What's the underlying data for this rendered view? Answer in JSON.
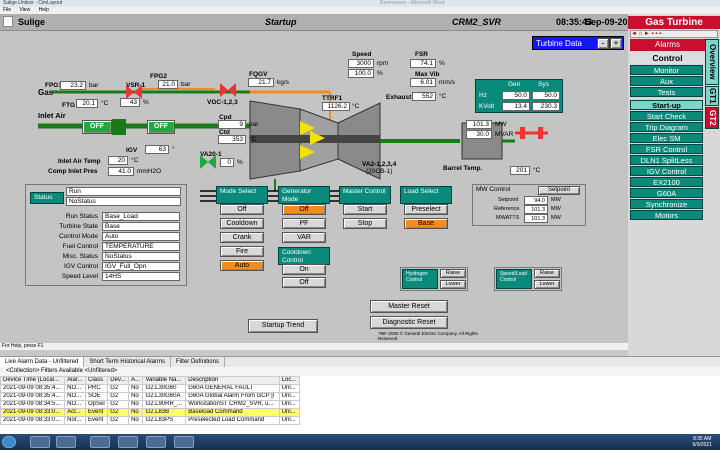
{
  "window": {
    "title": "Sulige.Unitsvr - CimLayout",
    "ghost_title": "Rasmussen - Microsoft Word",
    "menu": [
      "File",
      "View",
      "Help"
    ]
  },
  "header": {
    "site": "Sulige",
    "screen": "Startup",
    "unit": "CRM2_SVR",
    "time": "08:35:43",
    "date": "Sep-09-2021"
  },
  "turbine_data": {
    "label": "Turbine Data",
    "minus": "-",
    "plus": "+"
  },
  "speed": {
    "label": "Speed",
    "rpm": "3000",
    "rpm_unit": "rpm",
    "pct": "100.0",
    "pct_unit": "%"
  },
  "fsr": {
    "label": "FSR",
    "value": "74.1",
    "unit": "%"
  },
  "max_vib": {
    "label": "Max Vib",
    "value": "6.01",
    "unit": "mm/s"
  },
  "exhaust": {
    "label": "Exhaust",
    "value": "552",
    "unit": "°C"
  },
  "gen": {
    "gen_label": "Gen",
    "sys_label": "Sys",
    "hz_label": "Hz",
    "hz_gen": "50.0",
    "hz_sys": "50.0",
    "kv_label": "KVolt",
    "kv_gen": "13.4",
    "kv_sys": "230.3"
  },
  "fuel": {
    "fpg1_label": "FPG1",
    "fpg1": "23.2",
    "fpg1_unit": "bar",
    "gas_label": "Gas",
    "ftg_label": "FTG",
    "ftg": "20.1",
    "ftg_unit": "°C",
    "vsr_label": "VSR-1",
    "vsr": "43",
    "vsr_unit": "%",
    "fpg2_label": "FPG2",
    "fpg2": "21.0",
    "fpg2_unit": "bar",
    "fqgv_label": "FQGV",
    "fqgv": "21.7",
    "fqgv_unit": "kg/s",
    "vgc_label": "VGC-1,2,3",
    "ttrf1_label": "TTRF1",
    "ttrf1": "1126.2",
    "ttrf1_unit": "°C"
  },
  "compressor": {
    "inlet_air_label": "Inlet Air",
    "off1": "OFF",
    "off2": "OFF",
    "igv_label": "IGV",
    "igv": "63",
    "igv_unit": "°",
    "cpd_label": "Cpd",
    "cpd": "9",
    "cpd_unit": "bar",
    "ctd_label": "Ctd",
    "ctd": "353",
    "ctd_unit": "°C",
    "va20_label": "VA20-1",
    "va20": "0",
    "va20_unit": "%",
    "inlet_air_temp_label": "Inlet Air Temp",
    "inlet_air_temp": "20",
    "inlet_air_temp_unit": "°C",
    "comp_inlet_pres_label": "Comp Inlet Pres",
    "comp_inlet_pres": "41.0",
    "comp_inlet_pres_unit": "mmH2O",
    "va2_label": "VA2-1,2,3,4",
    "va2_sub": "(20CB-1)",
    "barrel_temp_label": "Barrel Temp.",
    "barrel_temp": "201",
    "barrel_temp_unit": "°C"
  },
  "generator": {
    "mw": "101.3",
    "mw_unit": "MW",
    "mvar": "30.0",
    "mvar_unit": "MVAR"
  },
  "status_panel": {
    "status_label": "Status",
    "status1": "Run",
    "status2": "NoStatus",
    "rows": [
      {
        "label": "Run Status",
        "value": "Base_Load"
      },
      {
        "label": "Turbine State",
        "value": "Base"
      },
      {
        "label": "Control Mode",
        "value": "Auto"
      },
      {
        "label": "Fuel Control",
        "value": "TEMPERATURE"
      },
      {
        "label": "Misc. Status",
        "value": "NoStatus"
      },
      {
        "label": "IGV Control",
        "value": "IGV_Full_Opn"
      },
      {
        "label": "Speed Level",
        "value": "14HS"
      }
    ]
  },
  "mode_select": {
    "title": "Mode Select",
    "options": [
      "Off",
      "Cooldown",
      "Crank",
      "Fire",
      "Auto"
    ],
    "active": "Auto"
  },
  "generator_mode": {
    "title": "Generator Mode",
    "options": [
      "Off",
      "PF",
      "VAR"
    ],
    "active": "Off"
  },
  "cooldown_control": {
    "title": "Cooldown Control",
    "options": [
      "On",
      "Off"
    ]
  },
  "master_control": {
    "title": "Master Control",
    "options": [
      "Start",
      "Stop"
    ]
  },
  "load_select": {
    "title": "Load Select",
    "options": [
      "Preselect",
      "Base"
    ],
    "active": "Base"
  },
  "mw_control": {
    "title": "MW Control",
    "setpoint_btn": "Setpoint",
    "rows": [
      {
        "label": "Setpoint",
        "value": "94.0",
        "unit": "MW"
      },
      {
        "label": "Reference",
        "value": "101.3",
        "unit": "MW"
      },
      {
        "label": "MWATTS",
        "value": "101.3",
        "unit": "MW"
      }
    ]
  },
  "hydrogen": {
    "title": "Hydrogen Control",
    "raise": "Raise",
    "lower": "Lower"
  },
  "speedload": {
    "title": "Speed/Load Control",
    "raise": "Raise",
    "lower": "Lower"
  },
  "actions": {
    "master_reset": "Master Reset",
    "diagnostic_reset": "Diagnostic Reset",
    "startup_trend": "Startup Trend"
  },
  "copyright": "?MF-2005 © General Electric Company. All Rights Reserved",
  "nav": {
    "title": "Gas Turbine",
    "top_items": [
      {
        "label": "Alarms",
        "style": "red"
      },
      {
        "label": "Control",
        "style": "grey"
      },
      {
        "label": "Monitor",
        "style": "teal"
      },
      {
        "label": "Aux",
        "style": "teal"
      },
      {
        "label": "Tests",
        "style": "teal"
      }
    ],
    "items": [
      "Start-up",
      "Start Check",
      "Trip Diagram",
      "Elec SM",
      "FSR Control",
      "DLN1 SplitLess",
      "IGV Control",
      "EX2100",
      "G60A",
      "Synchronize",
      "Motors"
    ],
    "tabs": [
      "Overview",
      "GT1",
      "GT2"
    ],
    "selected_tab": "GT2"
  },
  "status_bar": "For Help, press F1",
  "alarm": {
    "tabs": [
      "Live Alarm Data - Unfiltered",
      "Short Term Historical Alarms",
      "Filter Definitions"
    ],
    "toolbar": "<Collection>   Filters Available   <Unfiltered>",
    "columns": [
      "Device Time (Local...",
      "Alar...",
      "Class",
      "Dev...",
      "A...",
      "Variable Na...",
      "Description",
      "Loc..."
    ],
    "rows": [
      [
        "2021-09-09 08:35:4...",
        "NO...",
        "PRC",
        "G2",
        "No",
        "G2.L30G60",
        "G60A GENERAL FAULT",
        "Unl..."
      ],
      [
        "2021-09-09 08:35:4...",
        "NO...",
        "SOE",
        "G2",
        "No",
        "G2.L30G60A",
        "G60A Global Alarm From GCP [l",
        "Unl..."
      ],
      [
        "2021-09-09 08:34:5...",
        "NO...",
        "OpSel",
        "G2",
        "No",
        "G2.L90RR_...",
        "WorkstationST CRM2_SVR, u...",
        "Unl..."
      ],
      [
        "2021-09-09 08:33:0...",
        "Act...",
        "Event",
        "G2",
        "No",
        "G2.L83B",
        "Baseload Command",
        "Unl..."
      ],
      [
        "2021-09-09 08:33:0...",
        "Nor...",
        "Event",
        "G2",
        "No",
        "G2.L83PS",
        "Preselected Load Command",
        "Unl..."
      ]
    ],
    "highlight_row": 3
  },
  "clock": {
    "time": "8:35 AM",
    "date": "9/9/2021"
  }
}
